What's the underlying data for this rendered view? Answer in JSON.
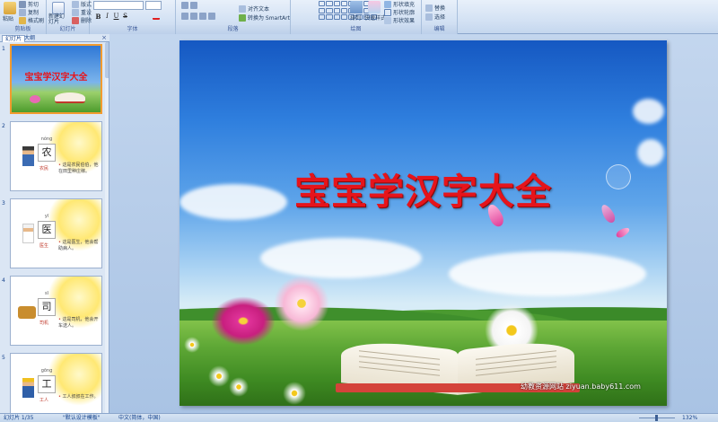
{
  "ribbon": {
    "clipboard": {
      "paste": "粘贴",
      "cut": "剪切",
      "copy": "复制",
      "format_painter": "格式刷",
      "label": "剪贴板"
    },
    "slides": {
      "new_slide": "新建幻灯片",
      "layout": "版式",
      "reset": "重设",
      "delete": "删除",
      "label": "幻灯片"
    },
    "font": {
      "bold": "B",
      "italic": "I",
      "underline": "U",
      "strike": "S",
      "label": "字体"
    },
    "paragraph": {
      "align_text": "对齐文本",
      "convert_smartart": "转换为 SmartArt",
      "label": "段落"
    },
    "drawing": {
      "arrange": "排列",
      "quick_styles": "快速样式",
      "shape_fill": "形状填充",
      "shape_outline": "形状轮廓",
      "shape_effects": "形状效果",
      "label": "绘图"
    },
    "editing": {
      "replace": "替换",
      "select": "选择",
      "label": "编辑"
    }
  },
  "panel_tabs": {
    "slides": "幻灯片",
    "outline": "大纲",
    "close": "×"
  },
  "thumbnails": [
    {
      "num": "1",
      "title": "宝宝学汉字大全"
    },
    {
      "num": "2",
      "pinyin": "nóng",
      "char": "农",
      "word": "农民",
      "text": "这是农民伯伯，他在田里种庄稼。"
    },
    {
      "num": "3",
      "pinyin": "yī",
      "char": "医",
      "word": "医生",
      "text": "这是医生，他会帮助病人。"
    },
    {
      "num": "4",
      "pinyin": "sī",
      "char": "司",
      "word": "司机",
      "text": "这是司机，他会开车送人。"
    },
    {
      "num": "5",
      "pinyin": "gōng",
      "char": "工",
      "word": "工人",
      "text": "工人叔叔在工作。"
    }
  ],
  "slide": {
    "title": "宝宝学汉字大全",
    "watermark": "幼教资源网站 ziyuan.baby611.com"
  },
  "status": {
    "slide_info": "幻灯片 1/35",
    "theme": "\"默认设计模板\"",
    "language": "中文(简体，中国)",
    "zoom": "132%"
  },
  "colors": {
    "title_red": "#e6141b",
    "selection_orange": "#f29b2f",
    "ribbon_text": "#15428b"
  }
}
